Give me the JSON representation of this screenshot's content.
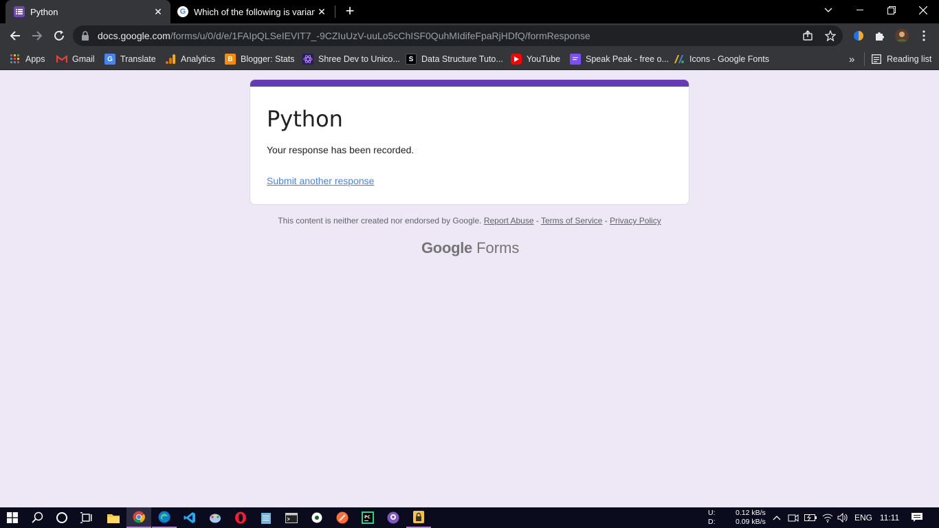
{
  "browser": {
    "tabs": [
      {
        "title": "Python",
        "icon": "google-forms-icon"
      },
      {
        "title": "Which of the following is variant",
        "icon": "google-icon"
      }
    ],
    "new_tab": "+",
    "url": {
      "host": "docs.google.com",
      "path": "/forms/u/0/d/e/1FAIpQLSeIEVIT7_-9CZIuUzV-uuLo5cChISF0QuhMIdifeFpaRjHDfQ/formResponse"
    },
    "bookmarks": [
      {
        "label": "Apps",
        "icon": "apps-grid-icon"
      },
      {
        "label": "Gmail",
        "icon": "gmail-icon"
      },
      {
        "label": "Translate",
        "icon": "translate-icon"
      },
      {
        "label": "Analytics",
        "icon": "analytics-icon"
      },
      {
        "label": "Blogger: Stats",
        "icon": "blogger-icon"
      },
      {
        "label": "Shree Dev to Unico...",
        "icon": "react-icon"
      },
      {
        "label": "Data Structure Tuto...",
        "icon": "s-logo-icon"
      },
      {
        "label": "YouTube",
        "icon": "youtube-icon"
      },
      {
        "label": "Speak Peak - free o...",
        "icon": "chat-icon"
      },
      {
        "label": "Icons - Google Fonts",
        "icon": "google-fonts-icon"
      }
    ],
    "bookmarks_overflow": "»",
    "reading_list": "Reading list"
  },
  "form": {
    "title": "Python",
    "message": "Your response has been recorded.",
    "link": "Submit another response",
    "accent": "#673ab7"
  },
  "footer": {
    "disclaimer": "This content is neither created nor endorsed by Google.",
    "report": "Report Abuse",
    "sep1": " - ",
    "terms": "Terms of Service",
    "sep2": " - ",
    "privacy": "Privacy Policy",
    "logo_google": "Google",
    "logo_forms": "Forms"
  },
  "taskbar": {
    "net_up_label": "U:",
    "net_up": "0.12 kB/s",
    "net_down_label": "D:",
    "net_down": "0.09 kB/s",
    "language": "ENG",
    "time": "11:11"
  }
}
